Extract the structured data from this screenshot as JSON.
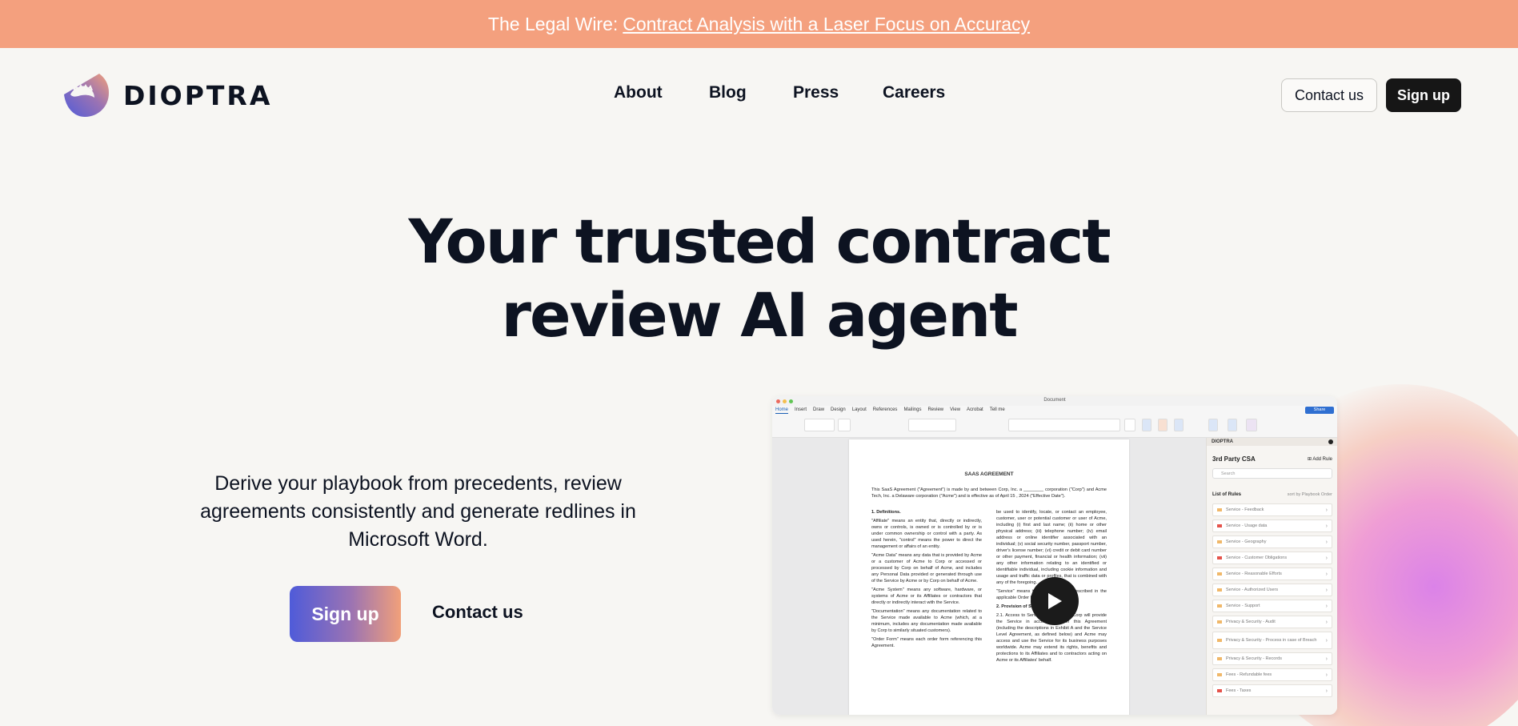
{
  "banner": {
    "prefix": "The Legal Wire:",
    "link": "Contract Analysis with a Laser Focus on Accuracy"
  },
  "brand": {
    "name": "DIOPTRA",
    "colors": {
      "banner": "#f4a07e",
      "dark": "#0d1321",
      "gradient_start": "#4f5bd9",
      "gradient_end": "#f1a07a"
    }
  },
  "nav": {
    "items": [
      {
        "label": "About"
      },
      {
        "label": "Blog"
      },
      {
        "label": "Press"
      },
      {
        "label": "Careers"
      }
    ],
    "contact_label": "Contact us",
    "signup_label": "Sign up"
  },
  "hero": {
    "headline_line1": "Your trusted contract",
    "headline_line2": "review AI agent",
    "subtitle": "Derive your playbook from precedents, review agreements consistently and generate redlines in Microsoft Word.",
    "signup_label": "Sign up",
    "contact_label": "Contact us"
  },
  "screenshot": {
    "window_title": "Document",
    "ribbon_tabs": [
      "Home",
      "Insert",
      "Draw",
      "Design",
      "Layout",
      "References",
      "Mailings",
      "Review",
      "View",
      "Acrobat",
      "Tell me"
    ],
    "share_label": "Share",
    "document": {
      "title": "SAAS AGREEMENT",
      "intro": "This SaaS Agreement (\"Agreement\") is made by and between Corp, Inc. a ________ corporation (\"Corp\") and Acme Tech, Inc. a Delaware corporation (\"Acme\") and is effective as of April 15 , 2024 (\"Effective Date\").",
      "section1": "1. Definitions.",
      "affiliate": "\"Affiliate\" means an entity that, directly or indirectly, owns or controls, is owned or is controlled by or is under common ownership or control with a party. As used herein, \"control\" means the power to direct the management or affairs of an entity.",
      "acme_data": "\"Acme Data\" means any data that is provided by Acme or a customer of Acme to Corp or accessed or processed by Corp on behalf of Acme, and includes any Personal Data provided or generated through use of the Service by Acme or by Corp on behalf of Acme.",
      "acme_system": "\"Acme System\" means any software, hardware, or systems of Acme or its Affiliates or contractors that directly or indirectly interact with the Service.",
      "documentation": "\"Documentation\" means any documentation related to the Service made available to Acme (which, at a minimum, includes any documentation made available by Corp to similarly situated customers).",
      "order_form": "\"Order Form\" means each order form referencing this Agreement.",
      "right_col1": "be used to identify, locate, or contact an employee, customer, user or potential customer or user of Acme, including (i) first and last name; (ii) home or other physical address; (iii) telephone number; (iv) email address or online identifier associated with an individual; (v) social security number, passport number, driver's license number; (vi) credit or debit card number or other payment, financial or health information; (vii) any other information relating to an identified or identifiable individual, including cookie information and usage and traffic data or profiles, that is combined with any of the foregoing.",
      "service": "\"Service\" means the hosted service described in the applicable Order Form.",
      "section2": "2. Provision of Service.",
      "access": "2.1. Access to Service. During Term, Corp will provide the Service in accordance with this Agreement (including the descriptions in Exhibit A and the Service Level Agreement, as defined below) and Acme may access and use the Service for its business purposes worldwide. Acme may extend its rights, benefits and protections to its Affiliates and to contractors acting on Acme or its Affiliates' behalf."
    },
    "panel": {
      "brand": "DIOPTRA",
      "title": "3rd Party CSA",
      "add_rule": "Add Rule",
      "search_placeholder": "Search",
      "rules_label": "List of Rules",
      "sort_label": "sort by  Playbook Order",
      "rules": [
        {
          "label": "Service - Feedback",
          "flag": "#f0b86a"
        },
        {
          "label": "Service - Usage data",
          "flag": "#e5534b"
        },
        {
          "label": "Service - Geography",
          "flag": "#f0b86a"
        },
        {
          "label": "Service - Customer Obligations",
          "flag": "#e5534b"
        },
        {
          "label": "Service - Reasonable Efforts",
          "flag": "#f0b86a"
        },
        {
          "label": "Service - Authorized Users",
          "flag": "#f0b86a"
        },
        {
          "label": "Service - Support",
          "flag": "#f0b86a"
        },
        {
          "label": "Privacy & Security - Audit",
          "flag": "#f0b86a"
        },
        {
          "label": "Privacy & Security - Process in case of Breach",
          "flag": "#f0b86a"
        },
        {
          "label": "Privacy & Security - Records",
          "flag": "#f0b86a"
        },
        {
          "label": "Fees - Refundable fees",
          "flag": "#f0b86a"
        },
        {
          "label": "Fees - Taxes",
          "flag": "#e5534b"
        }
      ]
    }
  }
}
